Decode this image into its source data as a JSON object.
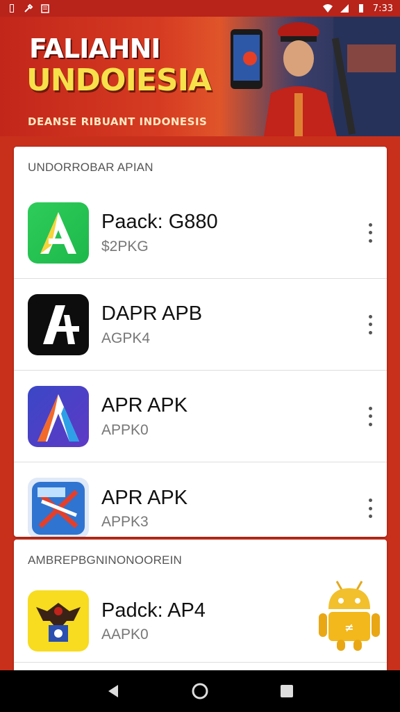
{
  "status_bar": {
    "time": "7:33",
    "icons": [
      "notification-icon",
      "tools-icon",
      "storage-icon",
      "wifi-icon",
      "signal-icon",
      "battery-icon"
    ]
  },
  "banner": {
    "title": "FALIAHNI",
    "subtitle": "UNDOIESIA",
    "tagline": "DEANSE RIBUANT INDONESIS"
  },
  "sections": [
    {
      "header": "UNDORROBAR APIAN",
      "apps": [
        {
          "name": "Paack: G880",
          "sub": "$2PKG",
          "icon": "green-a-icon"
        },
        {
          "name": "DAPR APB",
          "sub": "AGPK4",
          "icon": "black-a-icon"
        },
        {
          "name": "APR APK",
          "sub": "APPK0",
          "icon": "gradient-a-icon"
        },
        {
          "name": "APR APK",
          "sub": "APPK3",
          "icon": "blue-x-icon"
        }
      ]
    },
    {
      "header": "AMBREPBGNINONOOREIN",
      "apps": [
        {
          "name": "Padck: AP4",
          "sub": "AAPK0",
          "icon": "garuda-icon"
        }
      ]
    }
  ],
  "colors": {
    "background": "#c9301c",
    "status_bar": "#b8231a",
    "title_yellow": "#f7e14a"
  },
  "nav": {
    "icons": [
      "back-icon",
      "home-icon",
      "recents-icon"
    ]
  }
}
